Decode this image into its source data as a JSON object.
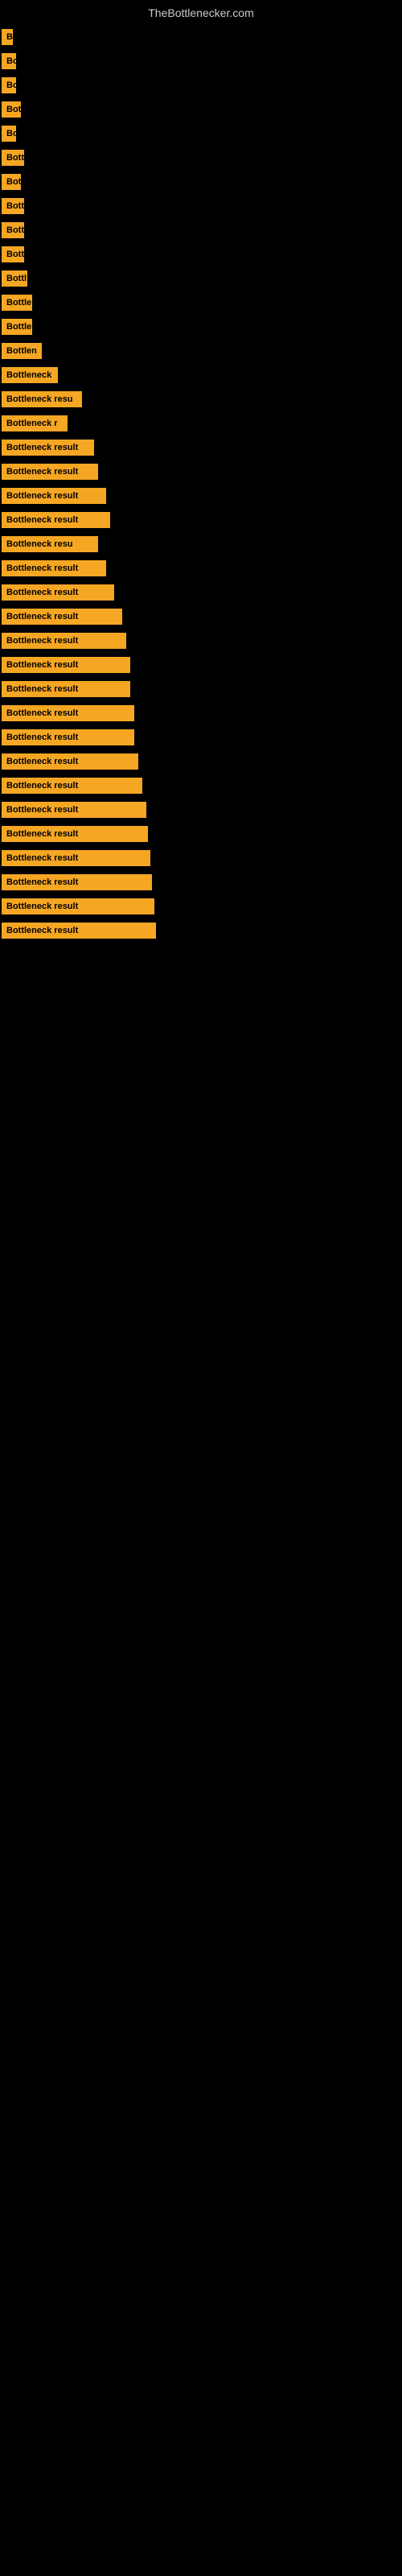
{
  "site": {
    "title": "TheBottlenecker.com"
  },
  "rows": [
    {
      "label": "B",
      "width": 14
    },
    {
      "label": "Bo",
      "width": 18
    },
    {
      "label": "Bo",
      "width": 18
    },
    {
      "label": "Bot",
      "width": 24
    },
    {
      "label": "Bo",
      "width": 18
    },
    {
      "label": "Bott",
      "width": 28
    },
    {
      "label": "Bot",
      "width": 24
    },
    {
      "label": "Bott",
      "width": 28
    },
    {
      "label": "Bott",
      "width": 28
    },
    {
      "label": "Bott",
      "width": 28
    },
    {
      "label": "Bottl",
      "width": 32
    },
    {
      "label": "Bottle",
      "width": 38
    },
    {
      "label": "Bottle",
      "width": 38
    },
    {
      "label": "Bottlen",
      "width": 50
    },
    {
      "label": "Bottleneck",
      "width": 70
    },
    {
      "label": "Bottleneck resu",
      "width": 100
    },
    {
      "label": "Bottleneck r",
      "width": 82
    },
    {
      "label": "Bottleneck result",
      "width": 115
    },
    {
      "label": "Bottleneck result",
      "width": 120
    },
    {
      "label": "Bottleneck result",
      "width": 130
    },
    {
      "label": "Bottleneck result",
      "width": 135
    },
    {
      "label": "Bottleneck resu",
      "width": 120
    },
    {
      "label": "Bottleneck result",
      "width": 130
    },
    {
      "label": "Bottleneck result",
      "width": 140
    },
    {
      "label": "Bottleneck result",
      "width": 150
    },
    {
      "label": "Bottleneck result",
      "width": 155
    },
    {
      "label": "Bottleneck result",
      "width": 160
    },
    {
      "label": "Bottleneck result",
      "width": 160
    },
    {
      "label": "Bottleneck result",
      "width": 165
    },
    {
      "label": "Bottleneck result",
      "width": 165
    },
    {
      "label": "Bottleneck result",
      "width": 170
    },
    {
      "label": "Bottleneck result",
      "width": 175
    },
    {
      "label": "Bottleneck result",
      "width": 180
    },
    {
      "label": "Bottleneck result",
      "width": 182
    },
    {
      "label": "Bottleneck result",
      "width": 185
    },
    {
      "label": "Bottleneck result",
      "width": 187
    },
    {
      "label": "Bottleneck result",
      "width": 190
    },
    {
      "label": "Bottleneck result",
      "width": 192
    }
  ]
}
